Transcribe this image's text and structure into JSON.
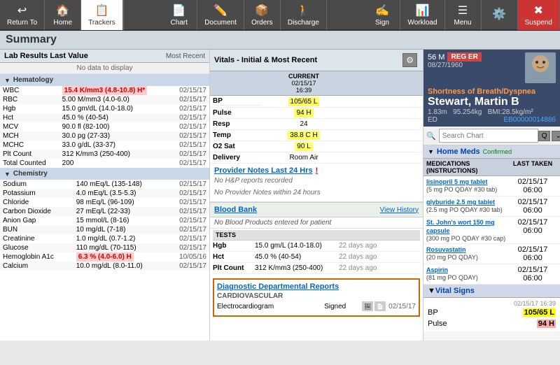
{
  "toolbar": {
    "buttons": [
      {
        "id": "return-to",
        "label": "Return To",
        "icon": "↩",
        "active": false
      },
      {
        "id": "home",
        "label": "Home",
        "icon": "🏠",
        "active": false
      },
      {
        "id": "trackers",
        "label": "Trackers",
        "icon": "📋",
        "active": true
      }
    ],
    "right_buttons": [
      {
        "id": "chart",
        "label": "Chart",
        "icon": "📄"
      },
      {
        "id": "document",
        "label": "Document",
        "icon": "✏️"
      },
      {
        "id": "orders",
        "label": "Orders",
        "icon": "📦"
      },
      {
        "id": "discharge",
        "label": "Discharge",
        "icon": "🚶"
      },
      {
        "id": "sign",
        "label": "Sign",
        "icon": "✍️"
      },
      {
        "id": "workload",
        "label": "Workload",
        "icon": "📊"
      },
      {
        "id": "menu",
        "label": "Menu",
        "icon": "☰"
      },
      {
        "id": "settings",
        "label": "",
        "icon": "⚙️"
      },
      {
        "id": "suspend",
        "label": "Suspend",
        "icon": "✖"
      }
    ]
  },
  "page_header": {
    "title": "Summary",
    "no_data": "No data to display"
  },
  "lab_panel": {
    "title": "Lab Results Last Value",
    "most_recent_label": "Most Recent",
    "sections": [
      {
        "name": "Hematology",
        "rows": [
          {
            "name": "WBC",
            "value": "15.4 K/mm3 (4.8-10.8) H*",
            "highlight": "red",
            "date": "02/15/17"
          },
          {
            "name": "RBC",
            "value": "5.00 M/mm3 (4.0-6.0)",
            "highlight": "none",
            "date": "02/15/17"
          },
          {
            "name": "Hgb",
            "value": "15.0 gm/dL (14.0-18.0)",
            "highlight": "none",
            "date": "02/15/17"
          },
          {
            "name": "Hct",
            "value": "45.0 % (40-54)",
            "highlight": "none",
            "date": "02/15/17"
          },
          {
            "name": "MCV",
            "value": "90.0 fl (82-100)",
            "highlight": "none",
            "date": "02/15/17"
          },
          {
            "name": "MCH",
            "value": "30.0 pg (27-33)",
            "highlight": "none",
            "date": "02/15/17"
          },
          {
            "name": "MCHC",
            "value": "33.0 g/dL (33-37)",
            "highlight": "none",
            "date": "02/15/17"
          },
          {
            "name": "Plt Count",
            "value": "312 K/mm3 (250-400)",
            "highlight": "none",
            "date": "02/15/17"
          },
          {
            "name": "Total Counted",
            "value": "200",
            "highlight": "none",
            "date": "02/15/17"
          }
        ]
      },
      {
        "name": "Chemistry",
        "rows": [
          {
            "name": "Sodium",
            "value": "140 mEq/L (135-148)",
            "highlight": "none",
            "date": "02/15/17"
          },
          {
            "name": "Potassium",
            "value": "4.0 mEq/L (3.5-5.3)",
            "highlight": "none",
            "date": "02/15/17"
          },
          {
            "name": "Chloride",
            "value": "98 mEq/L (96-109)",
            "highlight": "none",
            "date": "02/15/17"
          },
          {
            "name": "Carbon Dioxide",
            "value": "27 mEq/L (22-33)",
            "highlight": "none",
            "date": "02/15/17"
          },
          {
            "name": "Anion Gap",
            "value": "15 mmol/L (8-16)",
            "highlight": "none",
            "date": "02/15/17"
          },
          {
            "name": "BUN",
            "value": "10 mg/dL (7-18)",
            "highlight": "none",
            "date": "02/15/17"
          },
          {
            "name": "Creatinine",
            "value": "1.0 mg/dL (0.7-1.2)",
            "highlight": "none",
            "date": "02/15/17"
          },
          {
            "name": "Glucose",
            "value": "110 mg/dL (70-115)",
            "highlight": "none",
            "date": "02/15/17"
          },
          {
            "name": "Hemoglobin A1c",
            "value": "6.3 % (4.0-6.0) H",
            "highlight": "red",
            "date": "10/05/16"
          },
          {
            "name": "Calcium",
            "value": "10.0 mg/dL (8.0-11.0)",
            "highlight": "none",
            "date": "02/15/17"
          }
        ]
      }
    ]
  },
  "vitals_panel": {
    "title": "Vitals - Initial & Most Recent",
    "current_label": "CURRENT",
    "current_datetime": "02/15/17\n16:39",
    "rows": [
      {
        "label": "BP",
        "current": "105/65 L",
        "current_highlight": "yellow"
      },
      {
        "label": "Pulse",
        "current": "94 H",
        "current_highlight": "yellow"
      },
      {
        "label": "Resp",
        "current": "24",
        "current_highlight": "none"
      },
      {
        "label": "Temp",
        "current": "38.8 C H",
        "current_highlight": "yellow"
      },
      {
        "label": "O2 Sat",
        "current": "90 L",
        "current_highlight": "yellow"
      },
      {
        "label": "Delivery",
        "current": "Room Air",
        "current_highlight": "none"
      }
    ],
    "provider_notes": {
      "title": "Provider Notes Last 24 Hrs",
      "exclaim": "!",
      "no_hp": "No H&P reports recorded",
      "no_provider": "No Provider Notes within 24 hours"
    },
    "blood_bank": {
      "title": "Blood Bank",
      "view_history": "View History",
      "no_products": "No Blood Products entered for patient",
      "tests_label": "TESTS",
      "tests": [
        {
          "name": "Hgb",
          "value": "15.0 gm/L (14.0-18.0)",
          "date": "22 days ago"
        },
        {
          "name": "Hct",
          "value": "45.0 % (40-54)",
          "date": "22 days ago"
        },
        {
          "name": "Plt Count",
          "value": "312 K/mm3 (250-400)",
          "date": "22 days ago"
        }
      ]
    },
    "diag_reports": {
      "title": "Diagnostic Departmental Reports",
      "section": "CARDIOVASCULAR",
      "items": [
        {
          "name": "Electrocardiogram",
          "status": "Signed",
          "date": "02/15/17"
        }
      ]
    }
  },
  "patient": {
    "age": "56 M",
    "dob": "08/27/1960",
    "reg": "REG ER",
    "complaint": "Shortness of Breath/Dyspnea",
    "last_name": "Stewart,",
    "first_name": "Martin B",
    "height": "1.83m",
    "weight": "95.254kg",
    "bmi": "BMI:28.5kg/m²",
    "unit": "ED",
    "mrn": "EB00000014886",
    "search_placeholder": "Search Chart"
  },
  "home_meds": {
    "title": "Home Meds",
    "status": "Confirmed",
    "medications_label": "MEDICATIONS (INSTRUCTIONS)",
    "last_taken_label": "LAST TAKEN",
    "meds": [
      {
        "name": "lisinopril 5 mg tablet",
        "detail": "(5 mg PO QDAY #30 tab)",
        "last_taken": "02/15/17\n06:00"
      },
      {
        "name": "glyburide 2.5 mg tablet",
        "detail": "(2.5 mg PO QDAY #30 tab)",
        "last_taken": "02/15/17\n06:00"
      },
      {
        "name": "St. John's wort 150 mg capsule",
        "detail": "(300 mg PO QDAY #30 cap)",
        "last_taken": "02/15/17\n06:00"
      },
      {
        "name": "Rosuvastatin",
        "detail": "(20 mg PO QDAY)",
        "last_taken": "02/15/17\n06:00"
      },
      {
        "name": "Aspirin",
        "detail": "(81 mg PO QDAY)",
        "last_taken": "02/15/17\n06:00"
      }
    ]
  },
  "vital_signs_right": {
    "title": "Vital Signs",
    "timestamp": "02/15/17\n16:39",
    "rows": [
      {
        "label": "BP",
        "value": "105/65 L",
        "highlight": "yellow"
      },
      {
        "label": "Pulse",
        "value": "94 H",
        "highlight": "red"
      }
    ]
  }
}
